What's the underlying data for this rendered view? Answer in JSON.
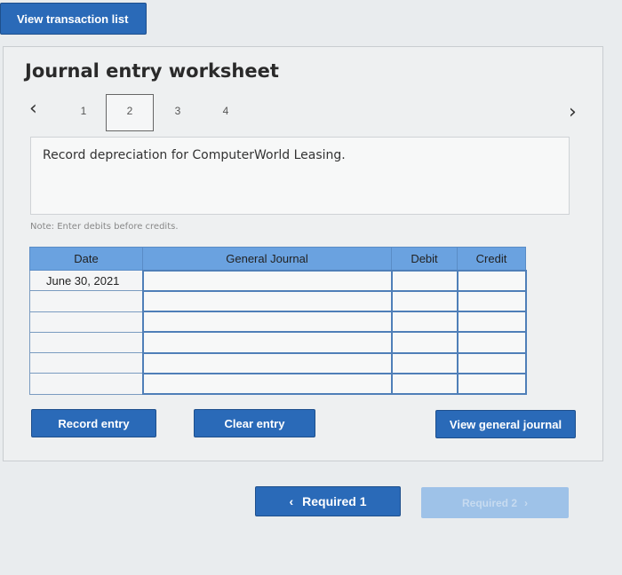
{
  "header": {
    "view_transaction_list": "View transaction list"
  },
  "worksheet": {
    "title": "Journal entry worksheet",
    "steps": [
      "1",
      "2",
      "3",
      "4"
    ],
    "active_step": "2",
    "instruction": "Record depreciation for ComputerWorld Leasing.",
    "note": "Note: Enter debits before credits."
  },
  "table": {
    "headers": {
      "date": "Date",
      "general_journal": "General Journal",
      "debit": "Debit",
      "credit": "Credit"
    },
    "rows": [
      {
        "date": "June 30, 2021",
        "account": "",
        "debit": "",
        "credit": ""
      },
      {
        "date": "",
        "account": "",
        "debit": "",
        "credit": ""
      },
      {
        "date": "",
        "account": "",
        "debit": "",
        "credit": ""
      },
      {
        "date": "",
        "account": "",
        "debit": "",
        "credit": ""
      },
      {
        "date": "",
        "account": "",
        "debit": "",
        "credit": ""
      },
      {
        "date": "",
        "account": "",
        "debit": "",
        "credit": ""
      }
    ]
  },
  "buttons": {
    "record_entry": "Record entry",
    "clear_entry": "Clear entry",
    "view_general_journal": "View general journal",
    "required_1": "Required 1",
    "required_2": "Required 2"
  },
  "icons": {
    "prev": "chevron-left-icon",
    "next": "chevron-right-icon"
  },
  "colors": {
    "accent": "#2a6ab8",
    "table_header": "#6aa2e0",
    "disabled": "#9ec2e8"
  }
}
